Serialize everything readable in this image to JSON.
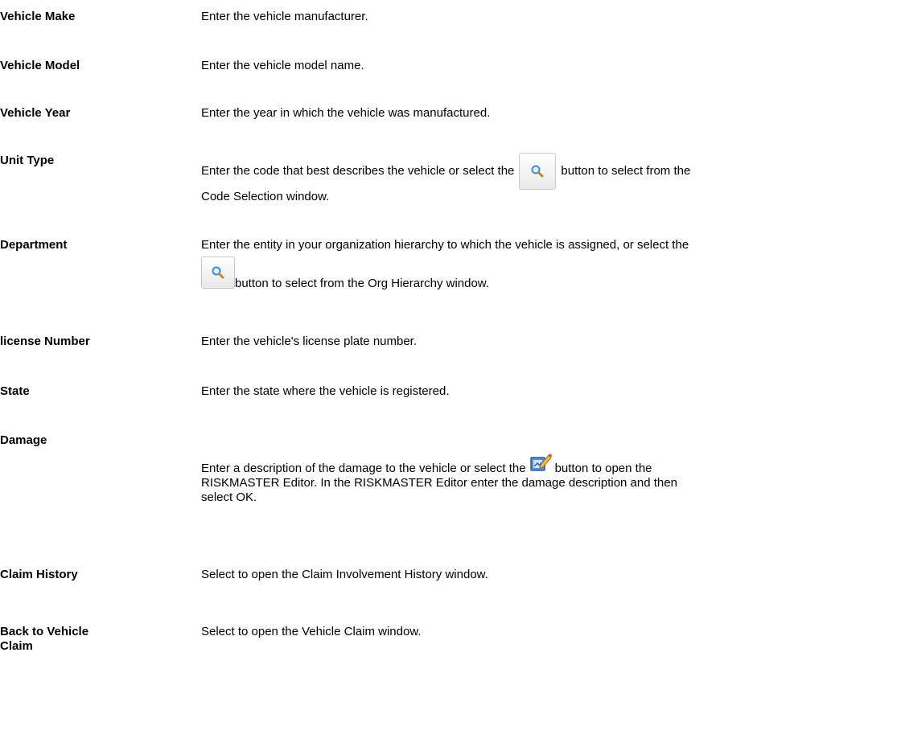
{
  "fields": {
    "vehicle_make": {
      "label": "Vehicle Make",
      "desc": "Enter the vehicle manufacturer."
    },
    "vehicle_model": {
      "label": "Vehicle Model",
      "desc": "Enter the vehicle model name."
    },
    "vehicle_year": {
      "label": "Vehicle Year",
      "desc": "Enter the year in which the vehicle was manufactured."
    },
    "unit_type": {
      "label": "Unit Type",
      "desc_a": "Enter the code that best describes the vehicle or select the",
      "desc_b": "button to select from the",
      "desc_c": "Code Selection window.",
      "icon": "search-icon"
    },
    "department": {
      "label": "Department",
      "desc_a": "Enter the entity in your organization hierarchy to which the vehicle is assigned, or select the",
      "desc_b": "button to select from the Org Hierarchy window.",
      "icon": "search-icon"
    },
    "license_number": {
      "label": "license Number",
      "desc": "Enter the vehicle's license plate number."
    },
    "state": {
      "label": "State",
      "desc": "Enter the state where the vehicle is registered."
    },
    "damage": {
      "label": "Damage",
      "desc_a": "Enter a description of the damage to the vehicle or select the",
      "desc_b": "button to open the",
      "desc_c": "RISKMASTER Editor. In the RISKMASTER Editor enter the damage description and then",
      "desc_d": "select OK.",
      "icon": "editor-icon"
    },
    "claim_history": {
      "label": "Claim History",
      "desc": "Select to open the Claim Involvement History window."
    },
    "back_to_vehicle_claim": {
      "label_a": "Back to Vehicle",
      "label_b": "Claim",
      "desc": "Select to open the Vehicle Claim window."
    }
  }
}
